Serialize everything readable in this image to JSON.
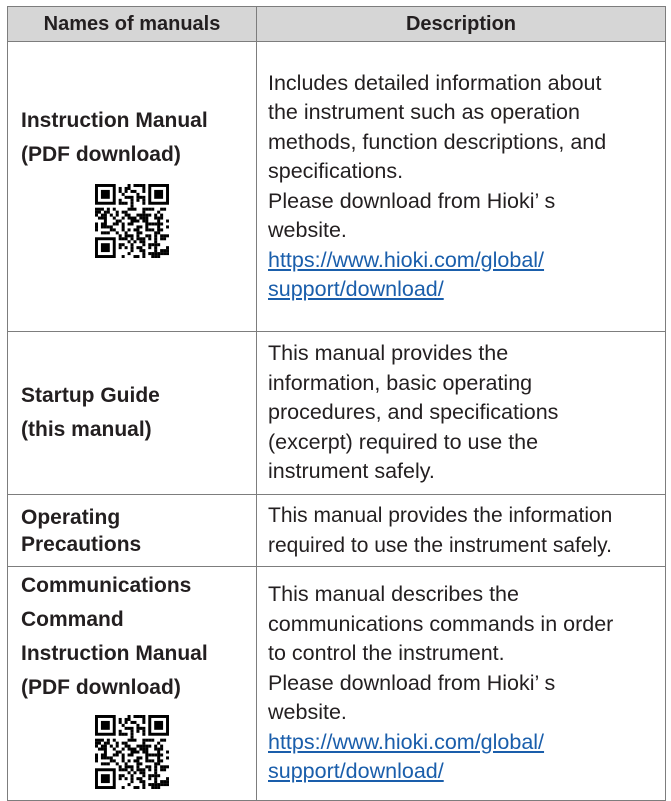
{
  "table": {
    "headers": [
      "Names of manuals",
      "Description"
    ],
    "rows": [
      {
        "name_lines": [
          "Instruction Manual",
          "(PDF download)"
        ],
        "qr": "qr-code-icon",
        "desc_lines": [
          "Includes detailed information about",
          "the instrument such as operation",
          "methods, function descriptions, and",
          "specifications.",
          "Please download from Hioki’ s",
          "website."
        ],
        "link_lines": [
          "https://www.hioki.com/global/",
          "support/download/"
        ]
      },
      {
        "name_lines": [
          "Startup Guide",
          "(this manual)"
        ],
        "desc_lines": [
          "This manual provides the",
          "information, basic operating",
          "procedures, and specifications",
          "(excerpt) required to use the",
          "instrument safely."
        ]
      },
      {
        "name_lines": [
          "Operating",
          "Precautions"
        ],
        "desc_lines": [
          "This manual provides the information",
          "required to use the instrument safely."
        ]
      },
      {
        "name_lines": [
          "Communications",
          "Command",
          "Instruction Manual",
          "(PDF download)"
        ],
        "qr": "qr-code-icon",
        "desc_lines": [
          "This manual describes the",
          "communications commands in order",
          "to control the instrument.",
          "Please download from Hioki’ s",
          "website."
        ],
        "link_lines": [
          "https://www.hioki.com/global/",
          "support/download/"
        ]
      }
    ]
  },
  "colors": {
    "header_bg": "#d6d6d6",
    "border": "#7d7d7d",
    "link": "#1a5eab",
    "text": "#231f20"
  }
}
